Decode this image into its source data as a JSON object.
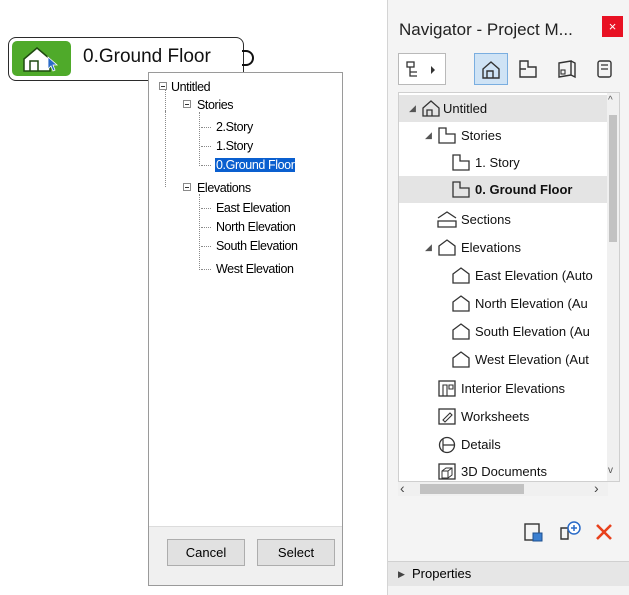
{
  "story_node": {
    "label": "0.Ground Floor"
  },
  "popup": {
    "tree": {
      "root": "Untitled",
      "stories_label": "Stories",
      "stories": [
        "2.Story",
        "1.Story",
        "0.Ground Floor"
      ],
      "elevations_label": "Elevations",
      "elevations": [
        "East Elevation",
        "North Elevation",
        "South Elevation",
        "West Elevation"
      ]
    },
    "cancel_label": "Cancel",
    "select_label": "Select"
  },
  "navigator": {
    "title": "Navigator - Project M...",
    "close_glyph": "×",
    "tree": {
      "root": "Untitled",
      "stories_label": "Stories",
      "stories": [
        "1. Story",
        "0. Ground Floor"
      ],
      "sections_label": "Sections",
      "elevations_label": "Elevations",
      "elevations": [
        "East Elevation (Auto",
        "North Elevation (Au",
        "South Elevation (Au",
        "West Elevation (Aut"
      ],
      "interior_label": "Interior Elevations",
      "worksheets_label": "Worksheets",
      "details_label": "Details",
      "docs3d_label": "3D Documents"
    },
    "properties_label": "Properties",
    "accent_selected": "#0a5fcf",
    "close_color": "#e81123"
  }
}
